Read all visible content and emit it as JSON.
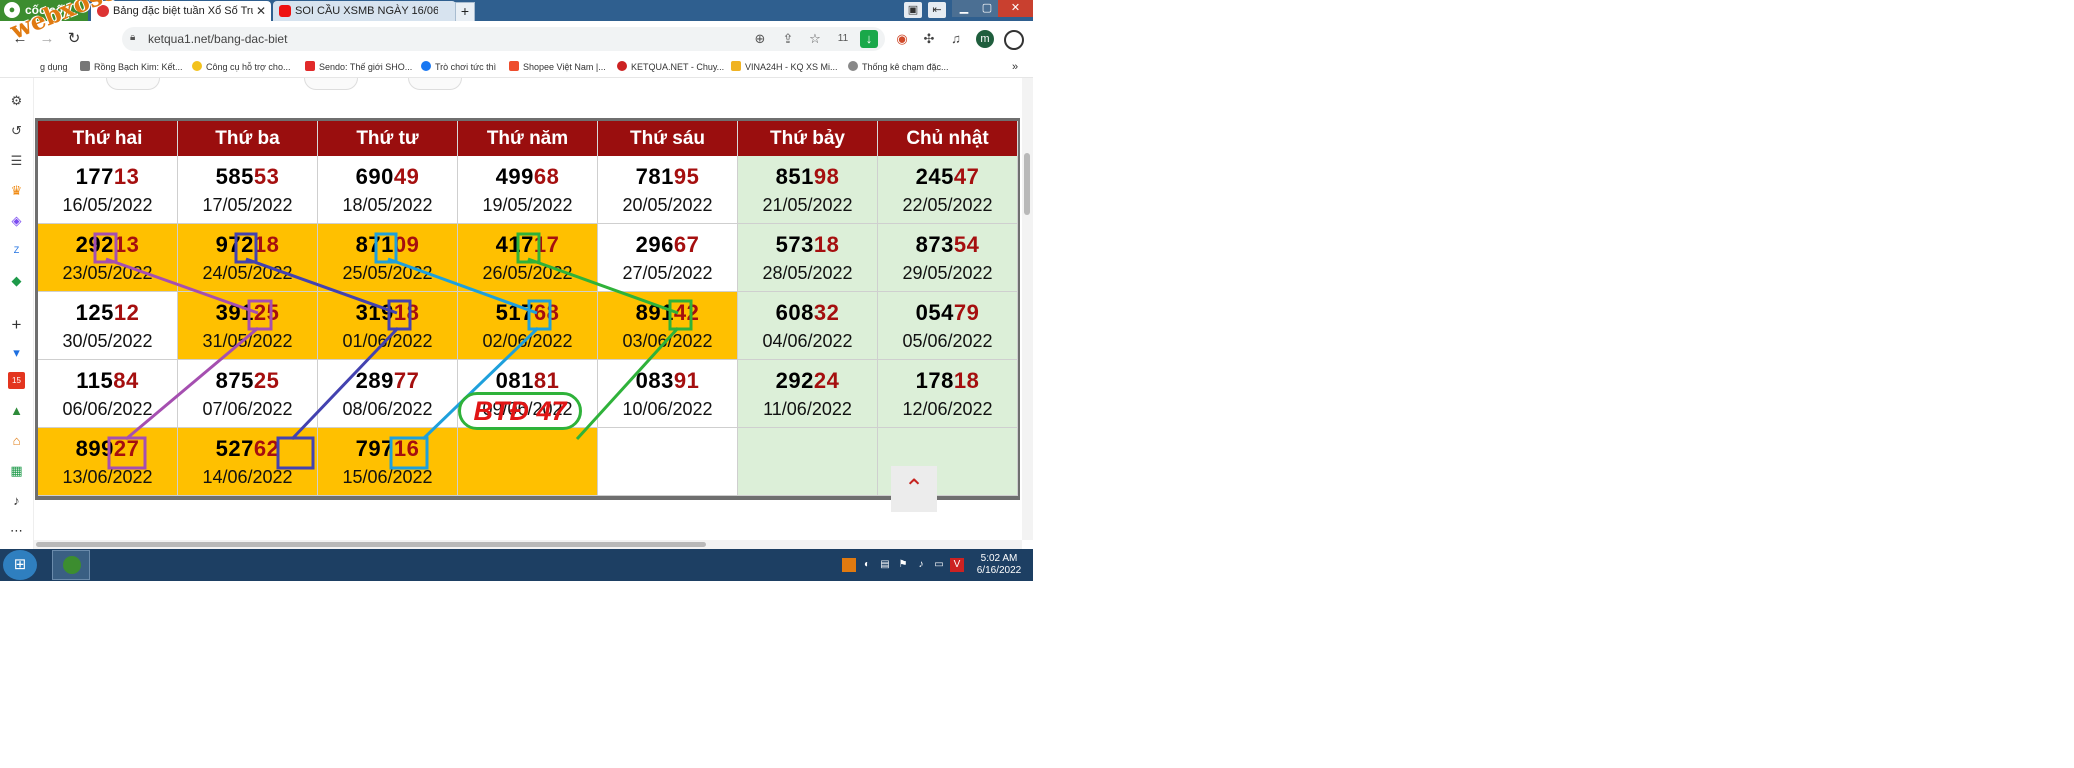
{
  "browser": {
    "brand": "cốc cốc",
    "tabs": [
      {
        "title": "Bảng đặc biệt tuần Xổ Số Tru"
      },
      {
        "title": "SOI CẦU XSMB NGÀY 16/06"
      }
    ],
    "new_tab": "+",
    "url": "ketqua1.net/bang-dac-biet",
    "avatar_letter": "m",
    "extension_badge": "11"
  },
  "bookmarks": [
    {
      "label": "g dụng"
    },
    {
      "label": "Rồng Bạch Kim: Kết..."
    },
    {
      "label": "Công cụ hỗ trợ cho..."
    },
    {
      "label": "Sendo: Thế giới SHO..."
    },
    {
      "label": "Trò chơi tức thì"
    },
    {
      "label": "Shopee Việt Nam |..."
    },
    {
      "label": "KETQUA.NET - Chuy..."
    },
    {
      "label": "VINA24H - KQ XS Mi..."
    },
    {
      "label": "Thống kê chạm đặc..."
    }
  ],
  "watermark": "webxoso.net",
  "table": {
    "headers": [
      "Thứ hai",
      "Thứ ba",
      "Thứ tư",
      "Thứ năm",
      "Thứ sáu",
      "Thứ bảy",
      "Chủ nhật"
    ],
    "rows": [
      [
        {
          "lead": "177",
          "tail": "13",
          "date": "16/05/2022",
          "bg": "w"
        },
        {
          "lead": "585",
          "tail": "53",
          "date": "17/05/2022",
          "bg": "w"
        },
        {
          "lead": "690",
          "tail": "49",
          "date": "18/05/2022",
          "bg": "w"
        },
        {
          "lead": "499",
          "tail": "68",
          "date": "19/05/2022",
          "bg": "w"
        },
        {
          "lead": "781",
          "tail": "95",
          "date": "20/05/2022",
          "bg": "w"
        },
        {
          "lead": "851",
          "tail": "98",
          "date": "21/05/2022",
          "bg": "g"
        },
        {
          "lead": "245",
          "tail": "47",
          "date": "22/05/2022",
          "bg": "g"
        }
      ],
      [
        {
          "lead": "292",
          "tail": "13",
          "date": "23/05/2022",
          "bg": "y"
        },
        {
          "lead": "972",
          "tail": "18",
          "date": "24/05/2022",
          "bg": "y"
        },
        {
          "lead": "871",
          "tail": "09",
          "date": "25/05/2022",
          "bg": "y"
        },
        {
          "lead": "417",
          "tail": "17",
          "date": "26/05/2022",
          "bg": "y"
        },
        {
          "lead": "296",
          "tail": "67",
          "date": "27/05/2022",
          "bg": "w"
        },
        {
          "lead": "573",
          "tail": "18",
          "date": "28/05/2022",
          "bg": "g"
        },
        {
          "lead": "873",
          "tail": "54",
          "date": "29/05/2022",
          "bg": "g"
        }
      ],
      [
        {
          "lead": "125",
          "tail": "12",
          "date": "30/05/2022",
          "bg": "w"
        },
        {
          "lead": "391",
          "tail": "25",
          "date": "31/05/2022",
          "bg": "y"
        },
        {
          "lead": "319",
          "tail": "18",
          "date": "01/06/2022",
          "bg": "y"
        },
        {
          "lead": "517",
          "tail": "68",
          "date": "02/06/2022",
          "bg": "y"
        },
        {
          "lead": "891",
          "tail": "42",
          "date": "03/06/2022",
          "bg": "y"
        },
        {
          "lead": "608",
          "tail": "32",
          "date": "04/06/2022",
          "bg": "g"
        },
        {
          "lead": "054",
          "tail": "79",
          "date": "05/06/2022",
          "bg": "g"
        }
      ],
      [
        {
          "lead": "115",
          "tail": "84",
          "date": "06/06/2022",
          "bg": "w"
        },
        {
          "lead": "875",
          "tail": "25",
          "date": "07/06/2022",
          "bg": "w"
        },
        {
          "lead": "289",
          "tail": "77",
          "date": "08/06/2022",
          "bg": "w"
        },
        {
          "lead": "081",
          "tail": "81",
          "date": "09/06/2022",
          "bg": "w"
        },
        {
          "lead": "083",
          "tail": "91",
          "date": "10/06/2022",
          "bg": "w"
        },
        {
          "lead": "292",
          "tail": "24",
          "date": "11/06/2022",
          "bg": "g"
        },
        {
          "lead": "178",
          "tail": "18",
          "date": "12/06/2022",
          "bg": "g"
        }
      ],
      [
        {
          "lead": "899",
          "tail": "27",
          "date": "13/06/2022",
          "bg": "y"
        },
        {
          "lead": "527",
          "tail": "62",
          "date": "14/06/2022",
          "bg": "y"
        },
        {
          "lead": "797",
          "tail": "16",
          "date": "15/06/2022",
          "bg": "y"
        },
        {
          "lead": "",
          "tail": "",
          "date": "",
          "bg": "y"
        },
        {
          "lead": "",
          "tail": "",
          "date": "",
          "bg": "w"
        },
        {
          "lead": "",
          "tail": "",
          "date": "",
          "bg": "g"
        },
        {
          "lead": "",
          "tail": "",
          "date": "",
          "bg": "g"
        }
      ]
    ]
  },
  "annotation": {
    "label": "BTĐ 47"
  },
  "annotation_colors": [
    "#a54fb0",
    "#4342b0",
    "#1ea0dc",
    "#2fb23a"
  ],
  "colors": {
    "header_bg": "#9a0e0e",
    "highlight_bg": "#ffc000",
    "weekend_bg": "#dcefd8",
    "tail_digits": "#a50f0f"
  },
  "taskbar": {
    "time": "5:02 AM",
    "date": "6/16/2022"
  }
}
